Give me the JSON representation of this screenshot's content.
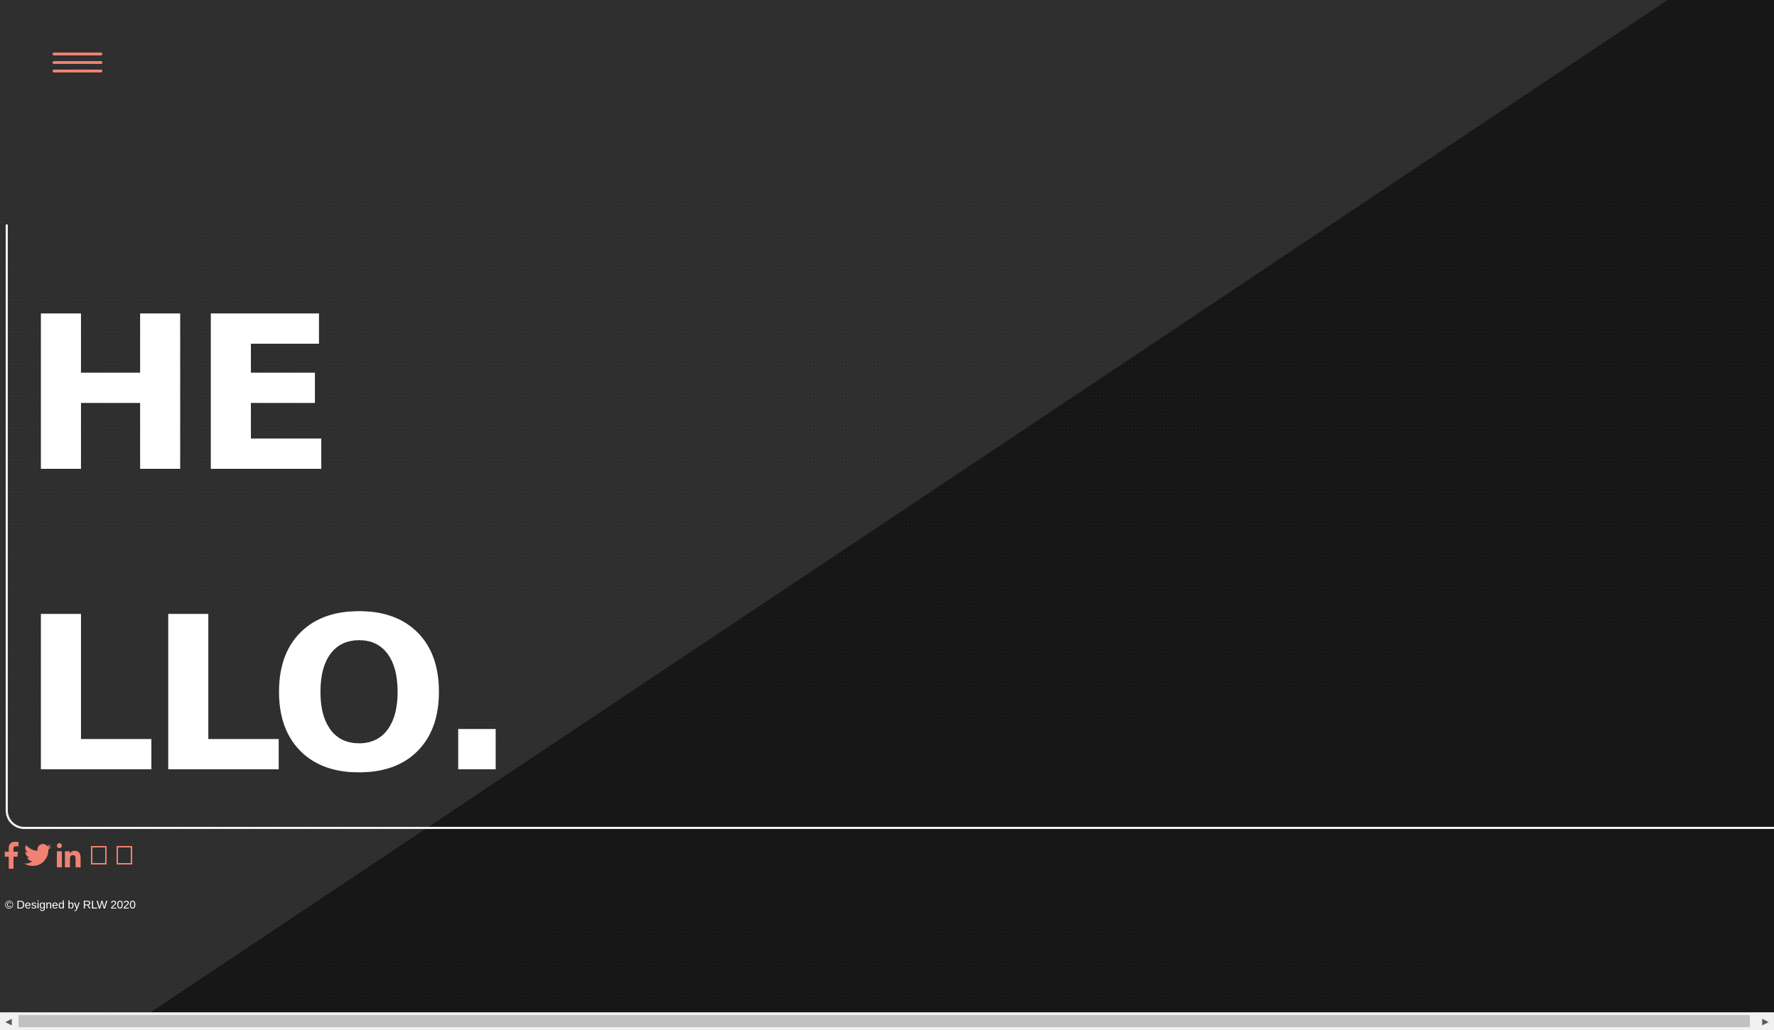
{
  "header": {
    "menu_icon": "hamburger-menu-icon"
  },
  "hero": {
    "line1": "HE",
    "line2": "LLO."
  },
  "social": {
    "icons": [
      "facebook-icon",
      "twitter-icon",
      "linkedin-icon",
      "missing-glyph-icon",
      "missing-glyph-icon"
    ]
  },
  "footer": {
    "copyright": "© Designed by RLW 2020"
  },
  "colors": {
    "accent": "#f08173",
    "text": "#ffffff",
    "background_light": "#2e2e2e",
    "background_dark": "#161616"
  },
  "scrollbar": {
    "left_arrow": "◀",
    "right_arrow": "▶"
  }
}
